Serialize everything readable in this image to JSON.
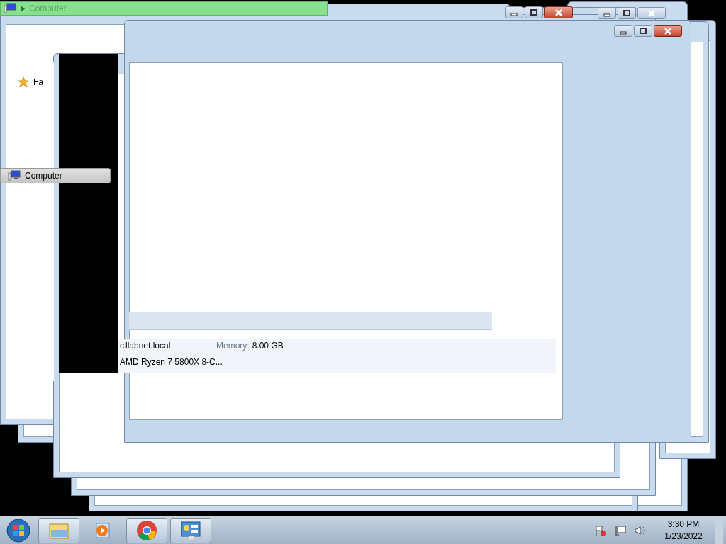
{
  "address_bar": {
    "location": "Computer"
  },
  "navigation": [
    {
      "label": "Fa",
      "kind": "favorites",
      "selected": false
    },
    {
      "label": "Computer",
      "kind": "computer",
      "selected": true
    }
  ],
  "details": {
    "name_start": "c",
    "name_rest": "llabnet.local",
    "memory_label": "Memory:",
    "memory": "8.00 GB",
    "cpu_start": "A",
    "cpu_rest": "MD Ryzen 7 5800X 8-C..."
  },
  "taskbar": {
    "buttons": [
      {
        "kind": "explorer",
        "selected": true
      },
      {
        "kind": "media",
        "selected": false
      },
      {
        "kind": "browser",
        "selected": true
      },
      {
        "kind": "control-panel",
        "selected": true
      }
    ]
  },
  "clock": {
    "time": "3:30 PM",
    "date": "1/23/2022"
  }
}
